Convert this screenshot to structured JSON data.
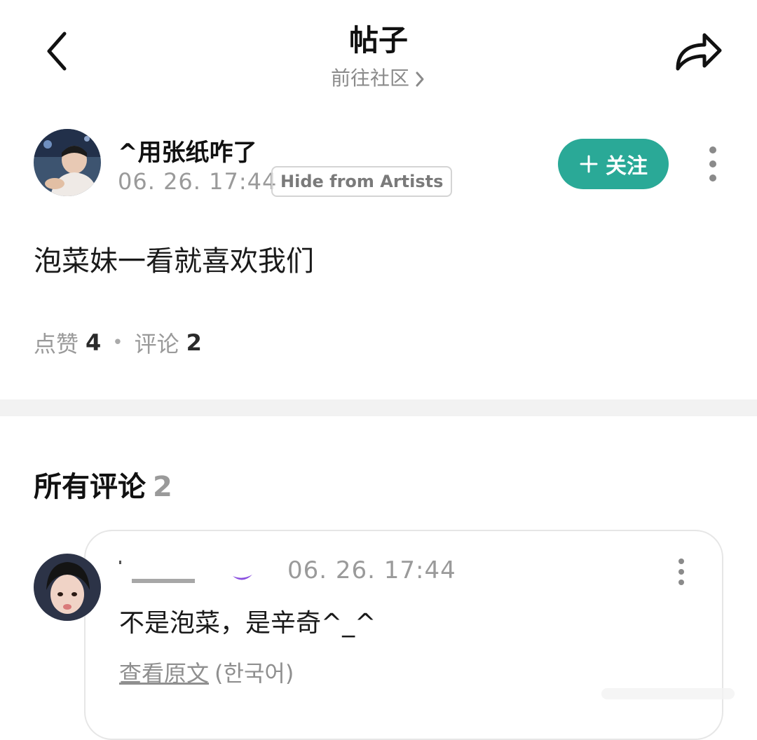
{
  "header": {
    "title": "帖子",
    "subnav_label": "前往社区"
  },
  "post": {
    "author_name": "^用张纸咋了",
    "time": "06. 26. 17:44",
    "badge": "Hide from Artists",
    "follow_label": "关注",
    "content": "泡菜妹一看就喜欢我们",
    "likes_label": "点赞",
    "likes_count": "4",
    "comments_label": "评论",
    "comments_count": "2"
  },
  "comments_section": {
    "title": "所有评论",
    "count": "2",
    "items": [
      {
        "time": "06. 26. 17:44",
        "text": "不是泡菜，是辛奇^_^",
        "translate_link": "查看原文",
        "language": "(한국어)"
      }
    ]
  },
  "colors": {
    "accent": "#2aa997",
    "divider": "#f2f2f2",
    "muted_text": "#9a9a9a"
  },
  "icons": [
    "back-icon",
    "share-icon",
    "chevron-right-icon",
    "plus-icon",
    "more-vertical-icon"
  ]
}
